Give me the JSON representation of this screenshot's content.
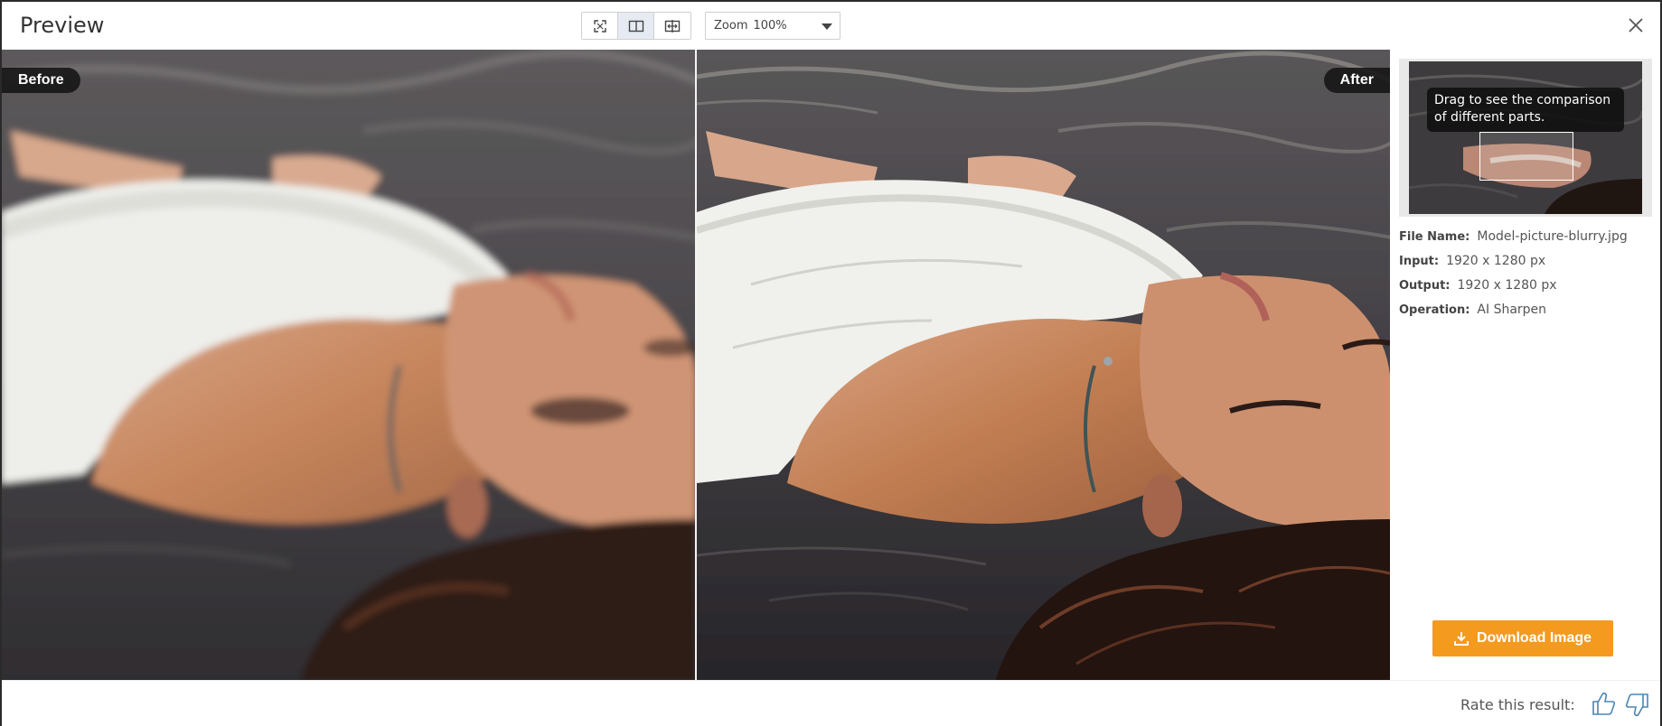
{
  "header": {
    "title": "Preview",
    "view_modes": [
      {
        "name": "fit-screen",
        "active": false
      },
      {
        "name": "side-by-side",
        "active": true
      },
      {
        "name": "split-compare",
        "active": false
      }
    ],
    "zoom": {
      "label": "Zoom",
      "value": "100%"
    }
  },
  "panes": {
    "before_label": "Before",
    "after_label": "After"
  },
  "side": {
    "tooltip": "Drag to see the comparison of different parts.",
    "info": {
      "file_name_label": "File Name:",
      "file_name": "Model-picture-blurry.jpg",
      "input_label": "Input:",
      "input": "1920 x 1280 px",
      "output_label": "Output:",
      "output": "1920 x 1280 px",
      "operation_label": "Operation:",
      "operation": "AI Sharpen"
    },
    "download_label": "Download Image"
  },
  "footer": {
    "rate_label": "Rate this result:"
  },
  "colors": {
    "accent": "#f49a1f",
    "badge_bg": "#141414",
    "active_view": "#e6ebf3"
  },
  "icons": {
    "fit": "fit-screen-icon",
    "side_by_side": "side-by-side-icon",
    "split": "split-compare-icon",
    "close": "close-icon",
    "download": "download-icon",
    "like": "thumbs-up-icon",
    "dislike": "thumbs-down-icon"
  }
}
